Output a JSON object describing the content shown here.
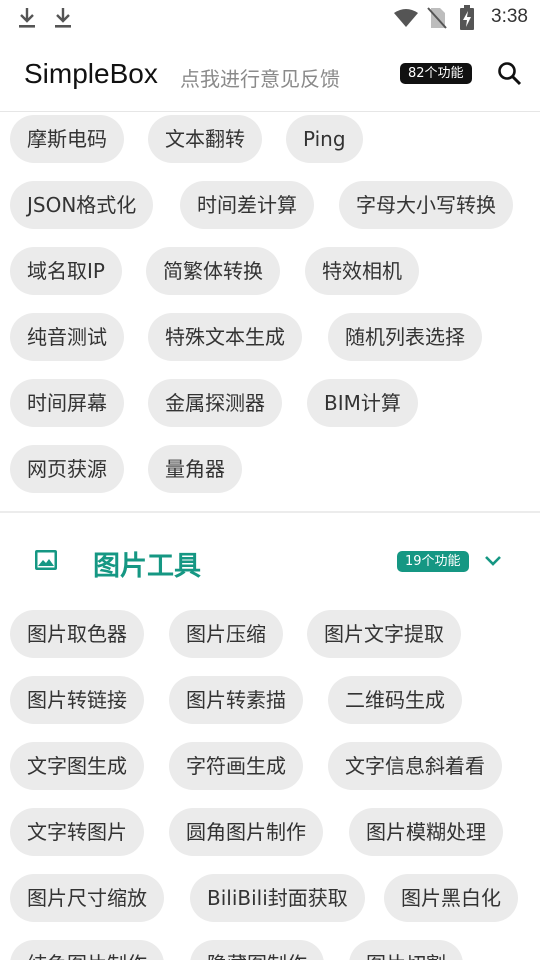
{
  "status_bar": {
    "time": "3:38",
    "icons": [
      "download-icon",
      "download-icon",
      "wifi-icon",
      "no-sim-icon",
      "battery-charging-icon"
    ]
  },
  "app_bar": {
    "title": "SimpleBox",
    "feedback": "点我进行意见反馈",
    "feature_count": "82个功能",
    "search_icon": "search-icon"
  },
  "section1": {
    "rows": [
      [
        "摩斯电码",
        "文本翻转",
        "Ping"
      ],
      [
        "JSON格式化",
        "时间差计算",
        "字母大小写转换"
      ],
      [
        "域名取IP",
        "简繁体转换",
        "特效相机"
      ],
      [
        "纯音测试",
        "特殊文本生成",
        "随机列表选择"
      ],
      [
        "时间屏幕",
        "金属探测器",
        "BIM计算"
      ],
      [
        "网页获源",
        "量角器"
      ]
    ]
  },
  "section2": {
    "icon": "image-icon",
    "title": "图片工具",
    "count": "19个功能",
    "chevron": "chevron-down-icon",
    "rows": [
      [
        "图片取色器",
        "图片压缩",
        "图片文字提取"
      ],
      [
        "图片转链接",
        "图片转素描",
        "二维码生成"
      ],
      [
        "文字图生成",
        "字符画生成",
        "文字信息斜着看"
      ],
      [
        "文字转图片",
        "圆角图片制作",
        "图片模糊处理"
      ],
      [
        "图片尺寸缩放",
        "BiliBili封面获取",
        "图片黑白化"
      ],
      [
        "纯色图片制作",
        "隐藏图制作",
        "图片切割"
      ]
    ]
  },
  "colors": {
    "accent": "#159783",
    "chip_bg": "#ebebeb",
    "pill_dark": "#111111"
  }
}
